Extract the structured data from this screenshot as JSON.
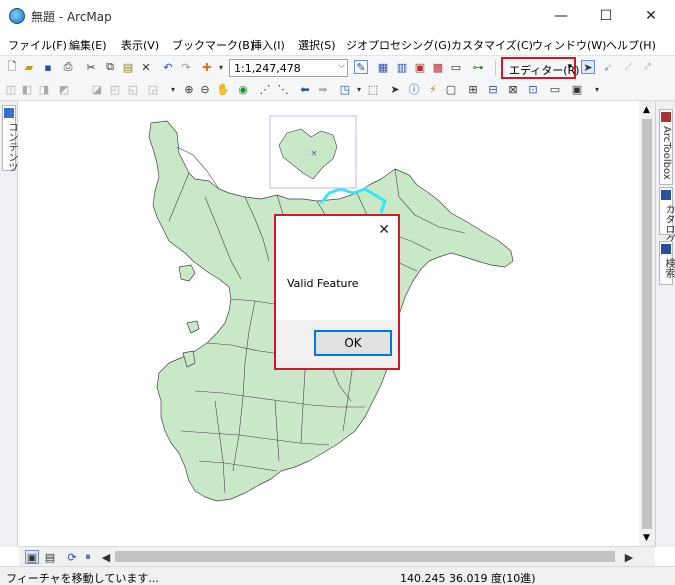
{
  "window": {
    "title": "無題 - ArcMap",
    "minimize": "—",
    "maximize": "☐",
    "close": "✕"
  },
  "menu": [
    "ファイル(F)",
    "編集(E)",
    "表示(V)",
    "ブックマーク(B)",
    "挿入(I)",
    "選択(S)",
    "ジオプロセシング(G)",
    "カスタマイズ(C)",
    "ウィンドウ(W)",
    "ヘルプ(H)"
  ],
  "toolbar": {
    "scale": "1:1,247,478",
    "scale_arrow": "⌵",
    "editor_label": "エディター(R)",
    "editor_arrow": "▾"
  },
  "left_dock": {
    "contents_tab": "コンテンツ"
  },
  "right_dock": {
    "arctoolbox_tab": "ArcToolbox",
    "catalog_tab": "カタログ",
    "search_tab": "検索"
  },
  "dialog": {
    "message": "Valid Feature",
    "ok_label": "OK",
    "close_glyph": "✕"
  },
  "status": {
    "left_text": "フィーチャを移動しています...",
    "coords": "140.245  36.019 度(10進)"
  },
  "colors": {
    "land": "#c8e8c8",
    "outline": "#444444",
    "highlight": "#39e6f0",
    "accent_red": "#d0182d"
  }
}
